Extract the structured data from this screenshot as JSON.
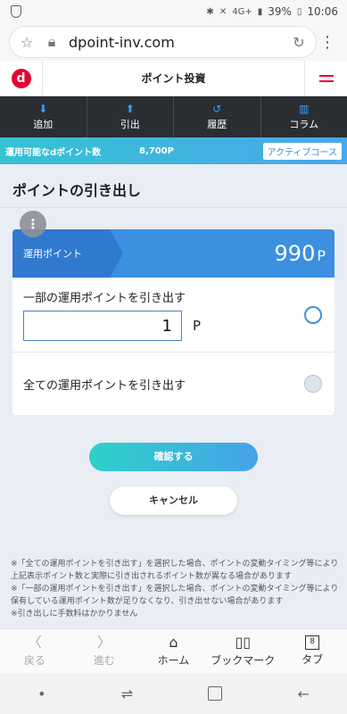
{
  "status": {
    "time": "10:06",
    "battery": "39%",
    "network": "4G+"
  },
  "browser": {
    "url": "dpoint-inv.com"
  },
  "header": {
    "title": "ポイント投資"
  },
  "nav": [
    {
      "label": "追加",
      "icon": "download-icon"
    },
    {
      "label": "引出",
      "icon": "upload-icon"
    },
    {
      "label": "履歴",
      "icon": "history-icon"
    },
    {
      "label": "コラム",
      "icon": "book-icon"
    }
  ],
  "points_bar": {
    "label": "運用可能なdポイント数",
    "value": "8,700P",
    "course": "アクティブコース"
  },
  "page": {
    "title": "ポイントの引き出し"
  },
  "card": {
    "head_label": "運用ポイント",
    "head_value": "990",
    "head_unit": "P",
    "option_partial": {
      "label": "一部の運用ポイントを引き出す",
      "value": "1",
      "unit": "P",
      "selected": true
    },
    "option_all": {
      "label": "全ての運用ポイントを引き出す",
      "selected": false
    }
  },
  "buttons": {
    "confirm": "確認する",
    "cancel": "キャンセル"
  },
  "notes": [
    "※「全ての運用ポイントを引き出す」を選択した場合、ポイントの変動タイミング等により上記表示ポイント数と実際に引き出されるポイント数が異なる場合があります",
    "※「一部の運用ポイントを引き出す」を選択した場合、ポイントの変動タイミング等により保有している運用ポイント数が足りなくなり、引き出せない場合があります",
    "※引き出しに手数料はかかりません"
  ],
  "browser_toolbar": {
    "back": "戻る",
    "forward": "進む",
    "home": "ホーム",
    "bookmarks": "ブックマーク",
    "tabs": "タブ",
    "tab_count": "8"
  }
}
